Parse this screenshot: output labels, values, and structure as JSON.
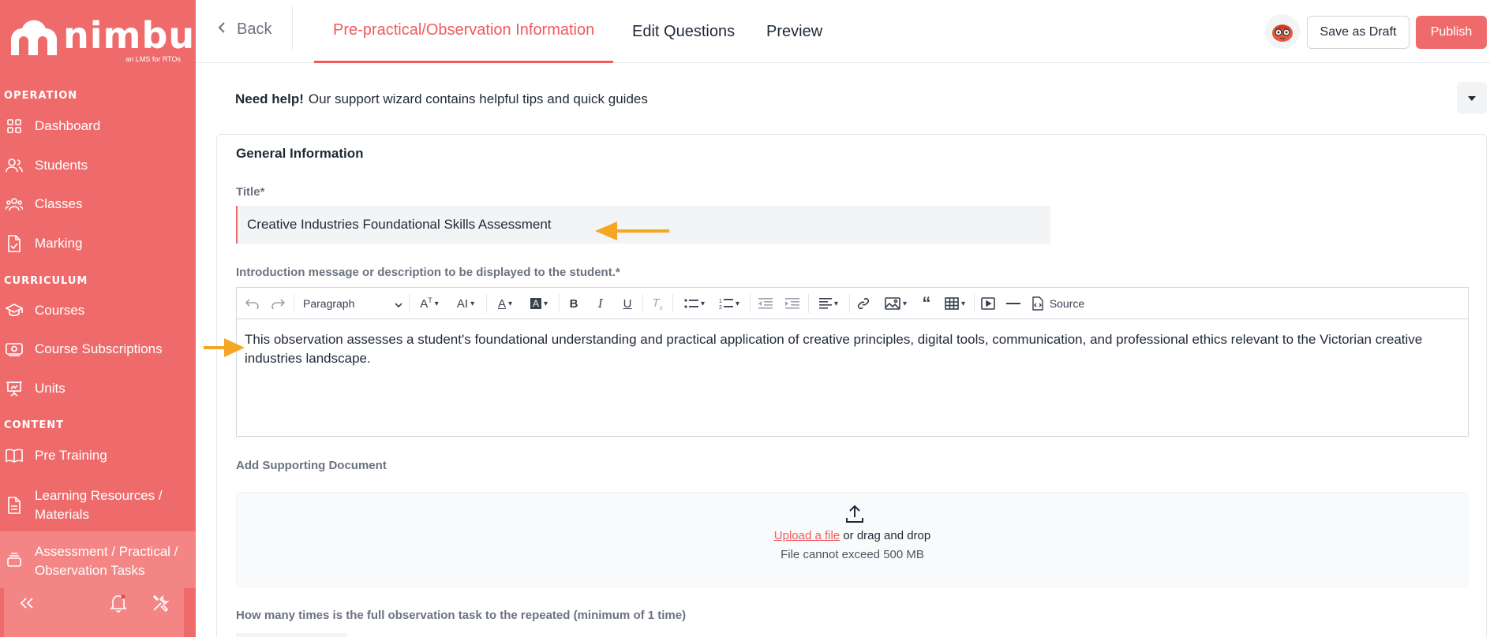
{
  "brand": {
    "name": "nimbu",
    "tagline": "an LMS for RTOs"
  },
  "sidebar": {
    "sections": [
      {
        "label": "OPERATION"
      },
      {
        "label": "CURRICULUM"
      },
      {
        "label": "CONTENT"
      }
    ],
    "items": [
      {
        "label": "Dashboard",
        "icon": "grid-icon"
      },
      {
        "label": "Students",
        "icon": "users-icon"
      },
      {
        "label": "Classes",
        "icon": "group-icon"
      },
      {
        "label": "Marking",
        "icon": "document-check-icon"
      },
      {
        "label": "Courses",
        "icon": "graduation-cap-icon"
      },
      {
        "label": "Course Subscriptions",
        "icon": "subscription-icon"
      },
      {
        "label": "Units",
        "icon": "presentation-icon"
      },
      {
        "label": "Pre Training",
        "icon": "book-icon"
      },
      {
        "label": "Learning Resources / Materials",
        "icon": "file-icon"
      },
      {
        "label": "Assessment / Practical / Observation Tasks",
        "icon": "stack-icon"
      }
    ],
    "bottom": [
      {
        "icon": "collapse-icon"
      },
      {
        "icon": "bell-icon"
      },
      {
        "icon": "tools-icon"
      }
    ]
  },
  "topbar": {
    "back_label": "Back",
    "tabs": [
      {
        "label": "Pre-practical/Observation Information",
        "active": true
      },
      {
        "label": "Edit Questions",
        "active": false
      },
      {
        "label": "Preview",
        "active": false
      }
    ],
    "save_draft_label": "Save as Draft",
    "publish_label": "Publish",
    "accent_color": "#ef6b6b"
  },
  "help": {
    "bold": "Need help!",
    "text": "Our support wizard contains helpful tips and quick guides"
  },
  "general": {
    "heading": "General Information",
    "title_label": "Title*",
    "title_value": "Creative Industries Foundational Skills Assessment",
    "intro_label": "Introduction message or description to be displayed to the student.*",
    "intro_text": "This observation assesses a student's foundational understanding and practical application of creative principles, digital tools, communication, and professional ethics relevant to the Victorian creative industries landscape.",
    "toolbar": {
      "paragraph": "Paragraph",
      "source": "Source"
    },
    "supporting_label": "Add Supporting Document",
    "upload_link": "Upload a file",
    "upload_text": " or drag and drop",
    "upload_limit": "File cannot exceed 500 MB",
    "repeat_label": "How many times is the full observation task to the repeated (minimum of 1 time)"
  }
}
